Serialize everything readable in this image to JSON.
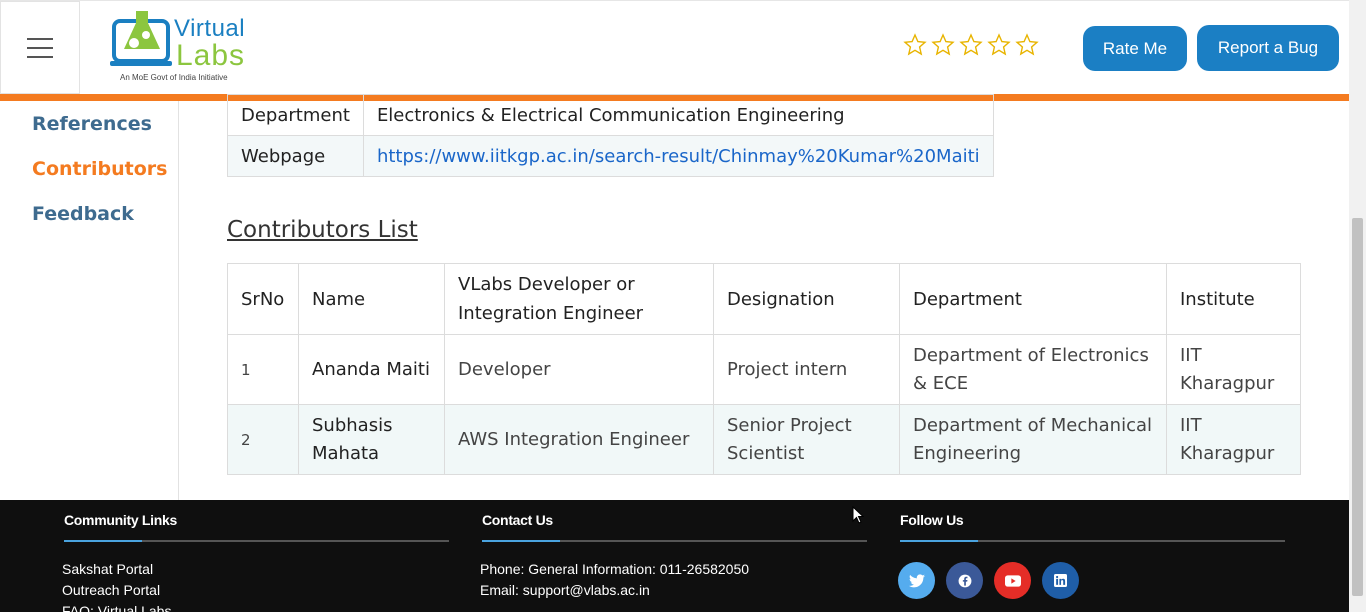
{
  "header": {
    "logo": {
      "line1": "Virtual",
      "line2": "Labs",
      "tagline": "An MoE Govt of India Initiative"
    },
    "rating_stars": 5,
    "rate_button": "Rate Me",
    "bug_button": "Report a Bug"
  },
  "sidebar": {
    "items": [
      {
        "label": "References"
      },
      {
        "label": "Contributors"
      },
      {
        "label": "Feedback"
      }
    ],
    "active": "Contributors"
  },
  "info": {
    "department_label": "Department",
    "department_value": "Electronics & Electrical Communication Engineering",
    "webpage_label": "Webpage",
    "webpage_value": "https://www.iitkgp.ac.in/search-result/Chinmay%20Kumar%20Maiti"
  },
  "contributors": {
    "title": "Contributors List",
    "headers": [
      "SrNo",
      "Name",
      "VLabs Developer or Integration Engineer",
      "Designation",
      "Department",
      "Institute"
    ],
    "rows": [
      {
        "srno": "1",
        "name": "Ananda Maiti",
        "role": "Developer",
        "designation": "Project intern",
        "department": "Department of Electronics & ECE",
        "institute": "IIT Kharagpur"
      },
      {
        "srno": "2",
        "name": "Subhasis Mahata",
        "role": "AWS Integration Engineer",
        "designation": "Senior Project Scientist",
        "department": "Department of Mechanical Engineering",
        "institute": "IIT Kharagpur"
      }
    ]
  },
  "footer": {
    "community": {
      "title": "Community Links",
      "items": [
        "Sakshat Portal",
        "Outreach Portal",
        "FAQ: Virtual Labs"
      ]
    },
    "contact": {
      "title": "Contact Us",
      "phone": "Phone: General Information: 011-26582050",
      "email": "Email: support@vlabs.ac.in"
    },
    "follow": {
      "title": "Follow Us",
      "icons": [
        "twitter-icon",
        "facebook-icon",
        "youtube-icon",
        "linkedin-icon"
      ]
    }
  },
  "colors": {
    "accent": "#f47b20",
    "brand_blue": "#1b7fc4",
    "link": "#1a66c9",
    "sidebar_link": "#3e6b8f",
    "footer_bg": "#0f0f0f"
  }
}
